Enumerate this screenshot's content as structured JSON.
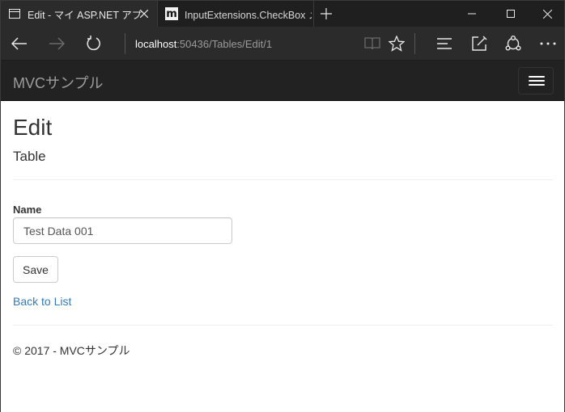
{
  "browser": {
    "tabs": [
      {
        "label": "Edit - マイ ASP.NET アプリ",
        "active": true,
        "icon": "page-icon"
      },
      {
        "label": "InputExtensions.CheckBox メ",
        "active": false,
        "icon": "m-logo-icon",
        "icon_text": "m"
      }
    ],
    "url_host": "localhost",
    "url_path": ":50436/Tables/Edit/1"
  },
  "site": {
    "brand": "MVCサンプル"
  },
  "page": {
    "title": "Edit",
    "subtitle": "Table",
    "name_label": "Name",
    "name_value": "Test Data 001",
    "save_label": "Save",
    "back_link": "Back to List",
    "footer": "© 2017 - MVCサンプル"
  },
  "colors": {
    "link": "#337ab7",
    "site_nav_bg": "#222222",
    "browser_bg": "#2b2b2b"
  }
}
